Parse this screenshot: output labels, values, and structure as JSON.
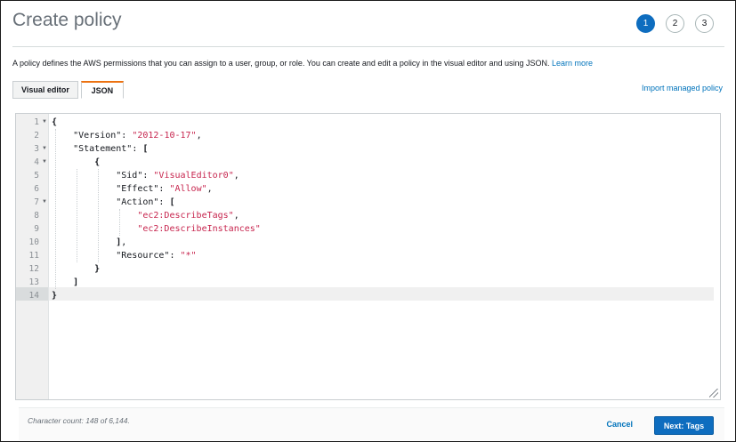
{
  "header": {
    "title": "Create policy",
    "steps": [
      "1",
      "2",
      "3"
    ],
    "active_step": "1"
  },
  "description": {
    "text": "A policy defines the AWS permissions that you can assign to a user, group, or role. You can create and edit a policy in the visual editor and using JSON.",
    "link": "Learn more"
  },
  "tabs": [
    {
      "label": "Visual editor",
      "active": false
    },
    {
      "label": "JSON",
      "active": true
    }
  ],
  "import_link": "Import managed policy",
  "editor": {
    "line_numbers": [
      "1",
      "2",
      "3",
      "4",
      "5",
      "6",
      "7",
      "8",
      "9",
      "10",
      "11",
      "12",
      "13",
      "14"
    ],
    "active_line": "14",
    "lines": [
      "{",
      "    \"Version\": \"2012-10-17\",",
      "    \"Statement\": [",
      "        {",
      "            \"Sid\": \"VisualEditor0\",",
      "            \"Effect\": \"Allow\",",
      "            \"Action\": [",
      "                \"ec2:DescribeTags\",",
      "                \"ec2:DescribeInstances\"",
      "            ],",
      "            \"Resource\": \"*\"",
      "        }",
      "    ]",
      "}"
    ],
    "tokens": {
      "version_key": "\"Version\"",
      "version_val": "\"2012-10-17\"",
      "statement_key": "\"Statement\"",
      "sid_key": "\"Sid\"",
      "sid_val": "\"VisualEditor0\"",
      "effect_key": "\"Effect\"",
      "effect_val": "\"Allow\"",
      "action_key": "\"Action\"",
      "action_1": "\"ec2:DescribeTags\"",
      "action_2": "\"ec2:DescribeInstances\"",
      "resource_key": "\"Resource\"",
      "resource_val": "\"*\""
    }
  },
  "footer": {
    "char_count": "Character count: 148 of 6,144.",
    "cancel": "Cancel",
    "next": "Next: Tags"
  },
  "colors": {
    "accent": "#0e6dbf",
    "tab_highlight": "#ec7211",
    "string": "#c7254e",
    "link": "#0073bb"
  }
}
